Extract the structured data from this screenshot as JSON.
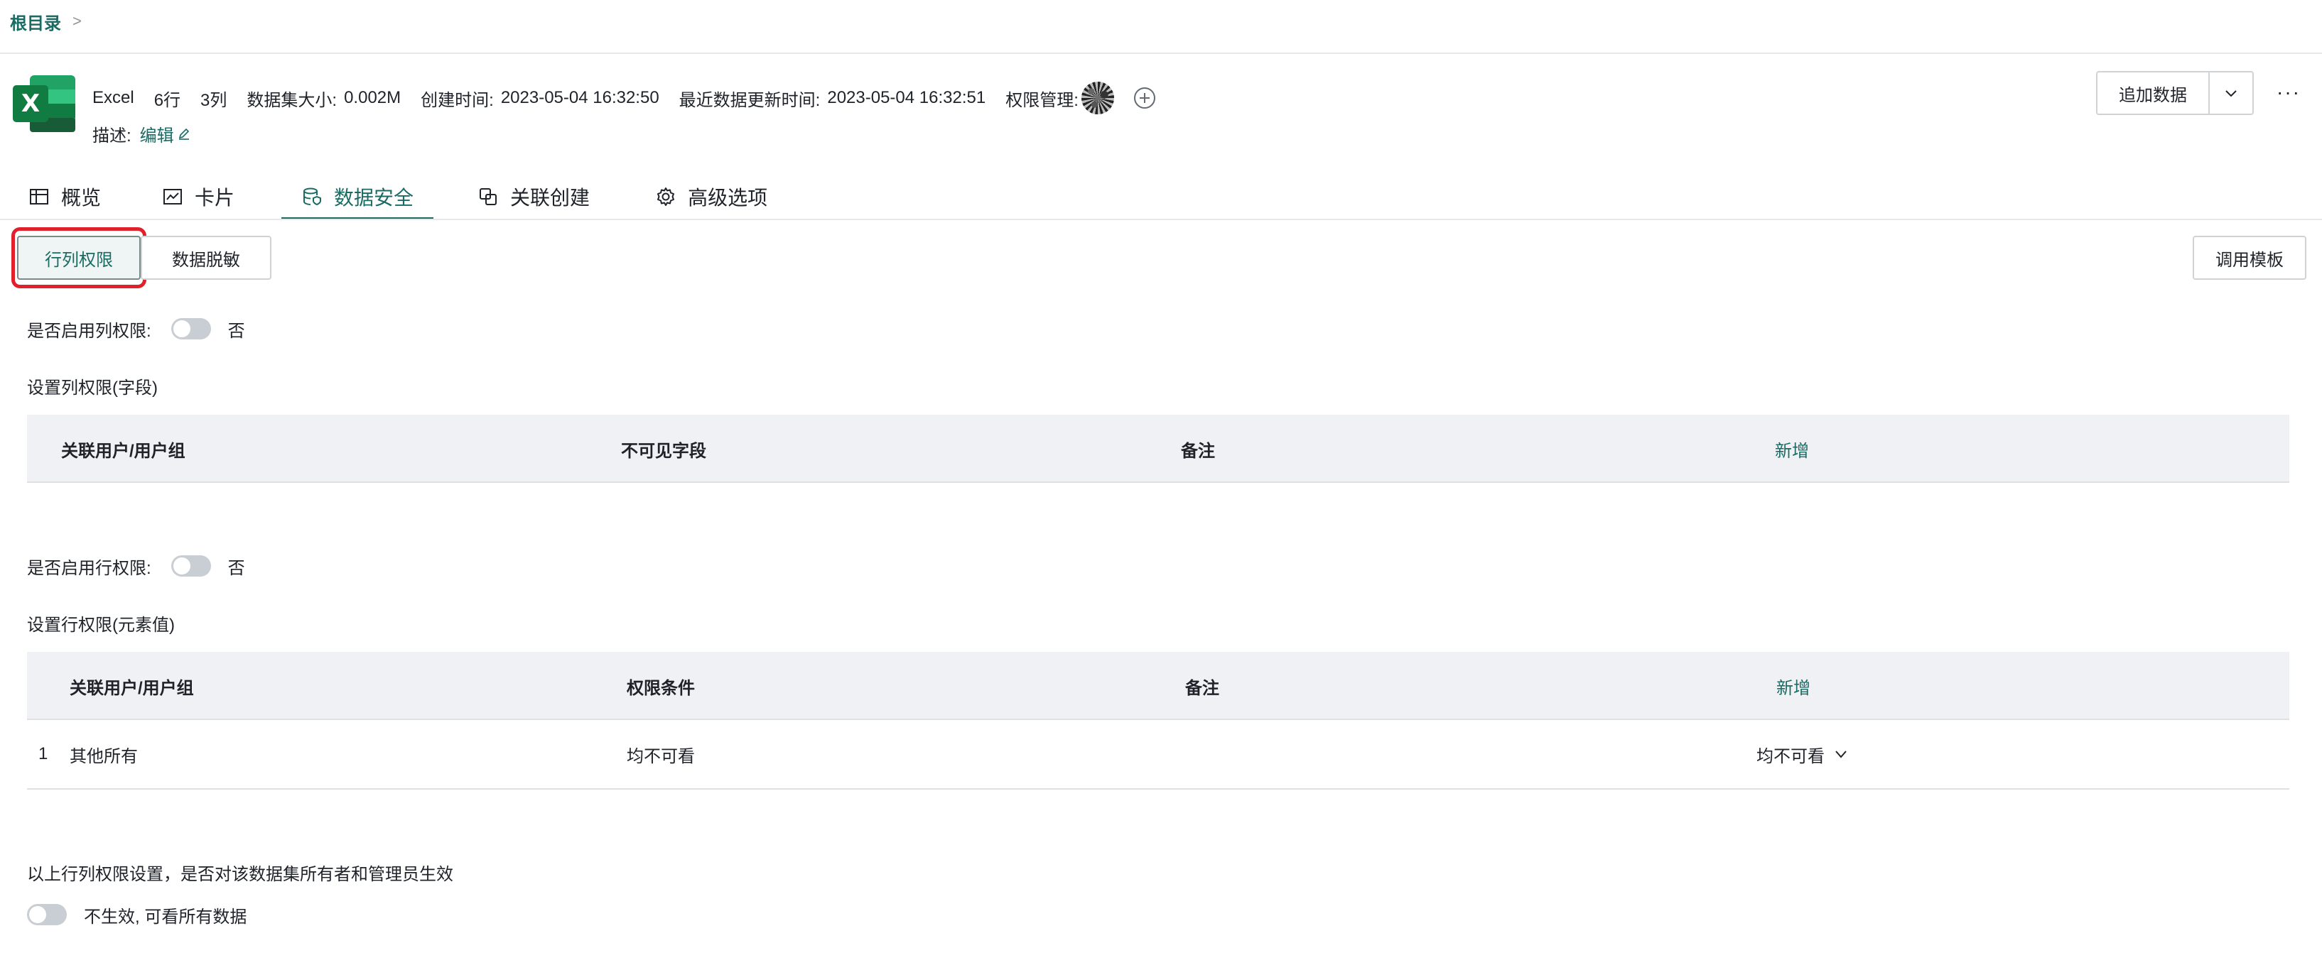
{
  "breadcrumb": {
    "root": "根目录",
    "separator": ">"
  },
  "dataset": {
    "type": "Excel",
    "rows": "6行",
    "cols": "3列",
    "size_label": "数据集大小:",
    "size_value": "0.002M",
    "created_label": "创建时间:",
    "created_value": "2023-05-04 16:32:50",
    "updated_label": "最近数据更新时间:",
    "updated_value": "2023-05-04 16:32:51",
    "permission_label": "权限管理:",
    "desc_label": "描述:",
    "desc_edit": "编辑"
  },
  "actions": {
    "append": "追加数据",
    "more": "···"
  },
  "tabs": [
    {
      "label": "概览",
      "icon": "table-icon"
    },
    {
      "label": "卡片",
      "icon": "chart-line-icon"
    },
    {
      "label": "数据安全",
      "icon": "database-shield-icon",
      "active": true
    },
    {
      "label": "关联创建",
      "icon": "link-create-icon"
    },
    {
      "label": "高级选项",
      "icon": "gear-icon"
    }
  ],
  "subtabs": {
    "row_col": "行列权限",
    "masking": "数据脱敏",
    "template": "调用模板"
  },
  "column_perm": {
    "toggle_label": "是否启用列权限:",
    "toggle_state": "否",
    "section_title": "设置列权限(字段)",
    "headers": [
      "关联用户/用户组",
      "不可见字段",
      "备注"
    ],
    "add": "新增"
  },
  "row_perm": {
    "toggle_label": "是否启用行权限:",
    "toggle_state": "否",
    "section_title": "设置行权限(元素值)",
    "headers": [
      "关联用户/用户组",
      "权限条件",
      "备注"
    ],
    "add": "新增",
    "rows": [
      {
        "index": "1",
        "user": "其他所有",
        "condition": "均不可看",
        "action": "均不可看"
      }
    ]
  },
  "owner_setting": {
    "question": "以上行列权限设置，是否对该数据集所有者和管理员生效",
    "toggle_state": "不生效, 可看所有数据"
  },
  "colors": {
    "accent": "#1a6b63",
    "highlight": "#e0202a",
    "excel_green": "#1d6f42"
  }
}
